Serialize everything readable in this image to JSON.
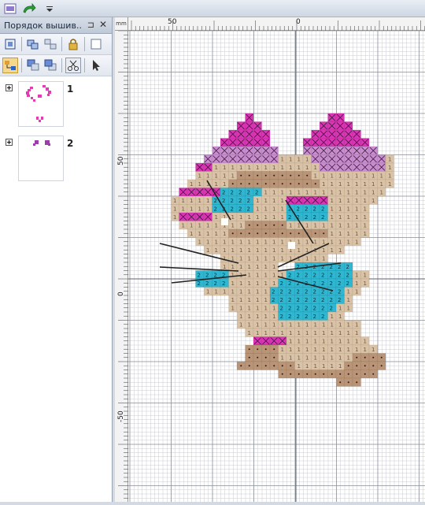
{
  "toolbar": {
    "app_icon": "app-logo-icon",
    "redo_icon": "redo-arrow-icon",
    "menu_icon": "dropdown-arrow-icon"
  },
  "panel": {
    "title": "Порядок вышив...",
    "pin_glyph": "⊐",
    "close_glyph": "✕",
    "row1": [
      "select-all-icon",
      "group-icon",
      "lock-icon",
      "frame-icon"
    ],
    "row2": [
      "sequence-icon",
      "move-back-icon",
      "move-forward-icon",
      "cut-icon",
      "pointer-icon"
    ]
  },
  "items": [
    {
      "number": "1",
      "color": "#e23bb5"
    },
    {
      "number": "2",
      "color": "#9b3fa8"
    }
  ],
  "ruler": {
    "corner": "mm",
    "top_labels": [
      "50",
      "0"
    ],
    "left_labels": [
      "50",
      "0",
      "-50"
    ]
  },
  "colors": {
    "pink": "#d935b4",
    "light_pink": "#c98ed0",
    "tan": "#d9c2a5",
    "brown": "#b99476",
    "cyan": "#2fb6d0",
    "grid": "#c7cbd1"
  }
}
